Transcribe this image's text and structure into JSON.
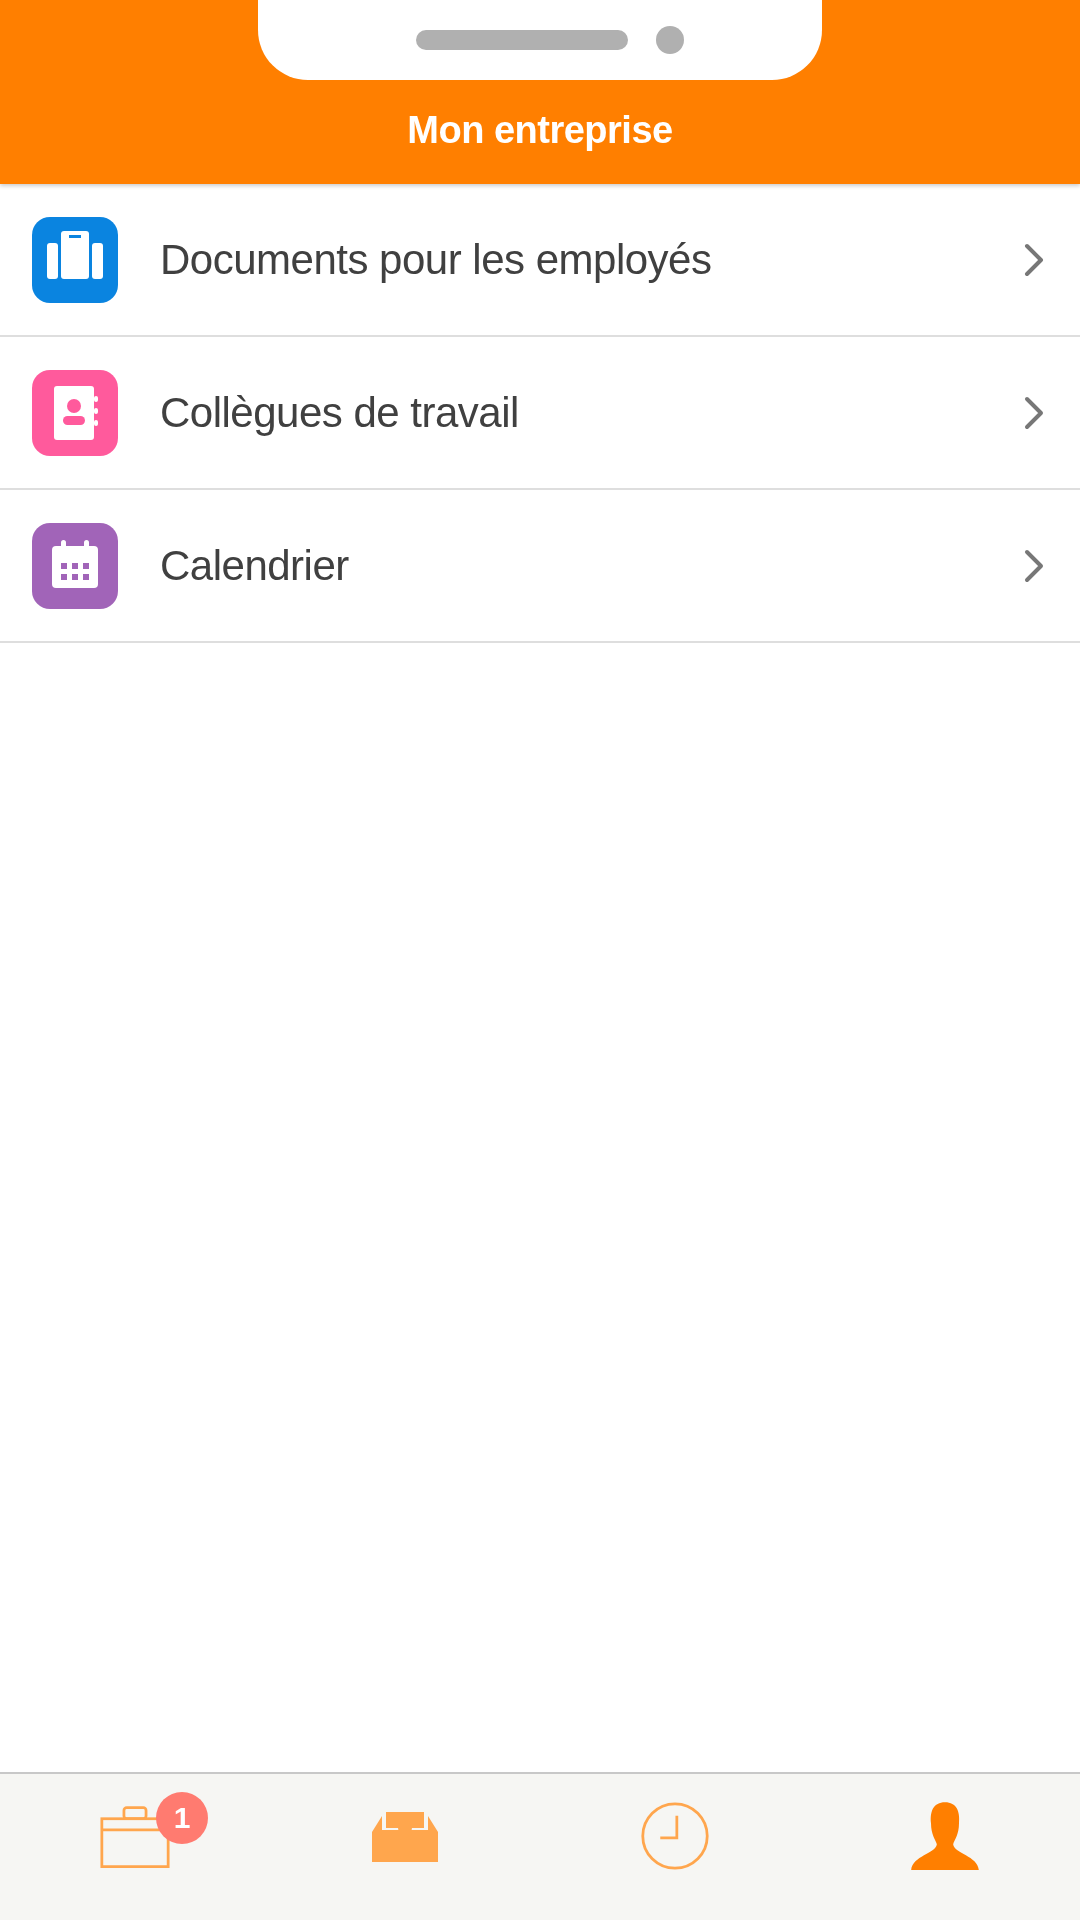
{
  "header": {
    "title": "Mon entreprise"
  },
  "menu_items": [
    {
      "kind": "documents",
      "label": "Documents pour les employés",
      "color": "#0a84e0"
    },
    {
      "kind": "contacts",
      "label": "Collègues de travail",
      "color": "#ff5a9c"
    },
    {
      "kind": "calendar",
      "label": "Calendrier",
      "color": "#a164b8"
    }
  ],
  "tab_bar": [
    {
      "kind": "briefcase",
      "selected": false,
      "badge": "1"
    },
    {
      "kind": "inbox",
      "selected": false
    },
    {
      "kind": "clock",
      "selected": false
    },
    {
      "kind": "profile",
      "selected": true
    }
  ]
}
